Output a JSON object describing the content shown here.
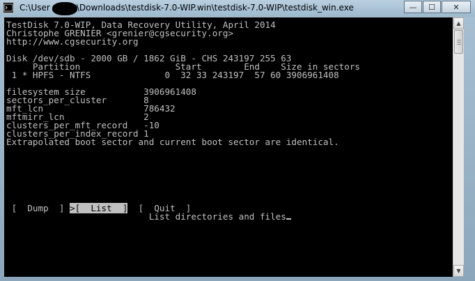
{
  "window": {
    "title_prefix": "C:\\User",
    "title_suffix": "\\Downloads\\testdisk-7.0-WIP.win\\testdisk-7.0-WIP\\testdisk_win.exe",
    "buttons": {
      "minimize": "—",
      "maximize": "☐",
      "close": "✕"
    }
  },
  "console": {
    "header": [
      "TestDisk 7.0-WIP, Data Recovery Utility, April 2014",
      "Christophe GRENIER <grenier@cgsecurity.org>",
      "http://www.cgsecurity.org"
    ],
    "disk": "Disk /dev/sdb - 2000 GB / 1862 GiB - CHS 243197 255 63",
    "table_header": "     Partition                  Start        End    Size in sectors",
    "partition_row": " 1 * HPFS - NTFS              0  32 33 243197  57 60 3906961408",
    "info": [
      "filesystem size           3906961408",
      "sectors_per_cluster       8",
      "mft_lcn                   786432",
      "mftmirr_lcn               2",
      "clusters_per_mft_record   -10",
      "clusters_per_index_record 1"
    ],
    "message": "Extrapolated boot sector and current boot sector are identical.",
    "menu": {
      "dump": " [  Dump  ] ",
      "list": ">[  List  ]",
      "quit": "  [  Quit  ]"
    },
    "hint": "                           List directories and files"
  },
  "colors": {
    "console_bg": "#000000",
    "console_fg": "#c0c0c0",
    "frame": "#9db8cc"
  }
}
